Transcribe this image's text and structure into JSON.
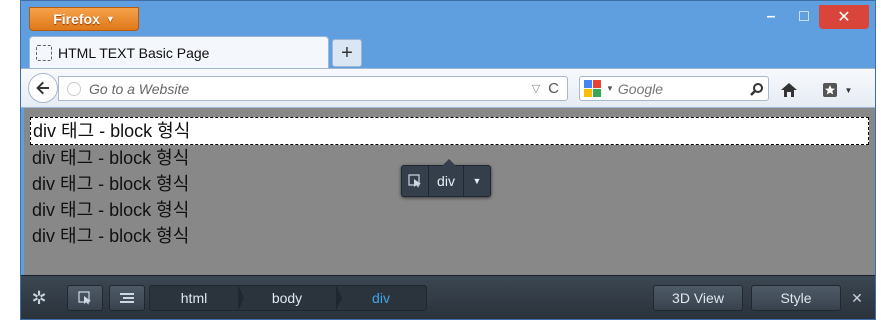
{
  "browser": {
    "menu_button": "Firefox",
    "tab_title": "HTML TEXT Basic Page",
    "new_tab": "+",
    "url_placeholder": "Go to a Website",
    "search_placeholder": "Google"
  },
  "window_controls": {
    "minimize": "–",
    "maximize": "□",
    "close": "✕"
  },
  "content": {
    "background": "#888888",
    "divs": [
      "div 태그 - block 형식",
      "div 태그 - block 형식",
      "div 태그 - block 형식",
      "div 태그 - block 형식",
      "div 태그 - block 형식"
    ]
  },
  "infobar": {
    "tag": "div"
  },
  "devtools": {
    "breadcrumbs": [
      "html",
      "body",
      "div"
    ],
    "view_3d": "3D View",
    "style": "Style",
    "accent": "#3fa5e8"
  }
}
